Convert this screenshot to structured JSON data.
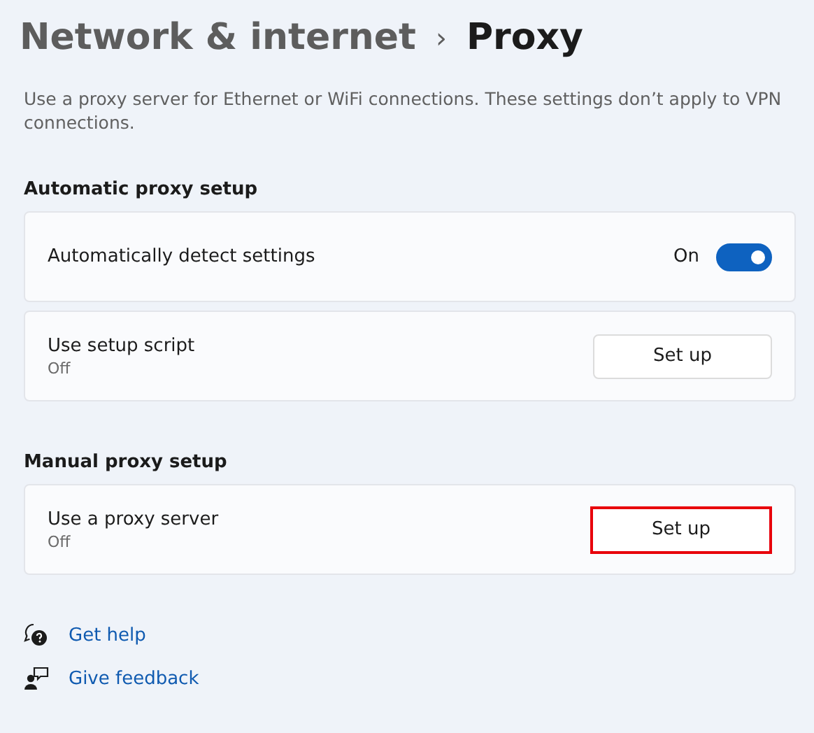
{
  "breadcrumb": {
    "parent": "Network & internet",
    "separator": "›",
    "current": "Proxy"
  },
  "description": "Use a proxy server for Ethernet or WiFi connections. These settings don’t apply to VPN connections.",
  "sections": [
    {
      "heading": "Automatic proxy setup",
      "rows": [
        {
          "kind": "toggle",
          "label": "Automatically detect settings",
          "state_text": "On",
          "on": true
        },
        {
          "kind": "button",
          "label": "Use setup script",
          "sublabel": "Off",
          "button": "Set up",
          "highlighted": false
        }
      ]
    },
    {
      "heading": "Manual proxy setup",
      "rows": [
        {
          "kind": "button",
          "label": "Use a proxy server",
          "sublabel": "Off",
          "button": "Set up",
          "highlighted": true
        }
      ]
    }
  ],
  "links": [
    {
      "kind": "help",
      "label": "Get help"
    },
    {
      "kind": "feedback",
      "label": "Give feedback"
    }
  ]
}
